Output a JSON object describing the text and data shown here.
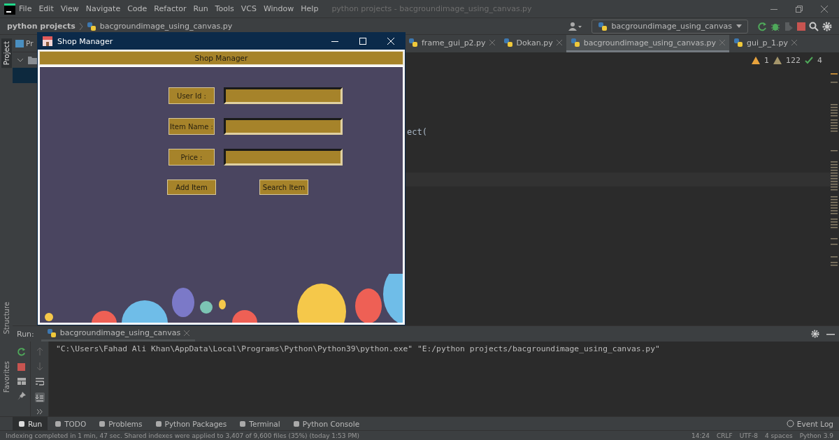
{
  "menu": [
    "File",
    "Edit",
    "View",
    "Navigate",
    "Code",
    "Refactor",
    "Run",
    "Tools",
    "VCS",
    "Window",
    "Help"
  ],
  "title": "python projects - bacgroundimage_using_canvas.py",
  "breadcrumb": {
    "project": "python projects",
    "file": "bacgroundimage_using_canvas.py"
  },
  "run_config": "bacgroundimage_using_canvas",
  "side_tabs": [
    {
      "label": "Project",
      "selected": true
    },
    {
      "label": "Structure",
      "selected": false
    },
    {
      "label": "Favorites",
      "selected": false
    }
  ],
  "project_panel": {
    "title": "Pr"
  },
  "editor_tabs": [
    {
      "label": "frame_gui_p2.py",
      "selected": false
    },
    {
      "label": "Dokan.py",
      "selected": false
    },
    {
      "label": "bacgroundimage_using_canvas.py",
      "selected": true
    },
    {
      "label": "gui_p_1.py",
      "selected": false
    }
  ],
  "inspections": {
    "errors": "1",
    "warnings": "122",
    "ok": "4"
  },
  "code_fragment": "ect(",
  "run_panel": {
    "label": "Run:",
    "tab": "bacgroundimage_using_canvas",
    "output": "\"C:\\Users\\Fahad Ali Khan\\AppData\\Local\\Programs\\Python\\Python39\\python.exe\" \"E:/python projects/bacgroundimage_using_canvas.py\""
  },
  "tool_tabs": [
    {
      "label": "Run",
      "selected": true
    },
    {
      "label": "TODO",
      "selected": false
    },
    {
      "label": "Problems",
      "selected": false
    },
    {
      "label": "Python Packages",
      "selected": false
    },
    {
      "label": "Terminal",
      "selected": false
    },
    {
      "label": "Python Console",
      "selected": false
    }
  ],
  "event_log": "Event Log",
  "status": {
    "message": "Indexing completed in 1 min, 47 sec. Shared indexes were applied to 3,407 of 9,600 files (35%) (today 1:53 PM)",
    "items": [
      "14:24",
      "CRLF",
      "UTF-8",
      "4 spaces",
      "Python 3.9"
    ]
  },
  "app_window": {
    "title": "Shop Manager",
    "header": "Shop Manager",
    "fields": [
      {
        "label": "User Id :"
      },
      {
        "label": "Item Name :"
      },
      {
        "label": "Price :"
      }
    ],
    "buttons": [
      "Add Item",
      "Search Item"
    ]
  }
}
